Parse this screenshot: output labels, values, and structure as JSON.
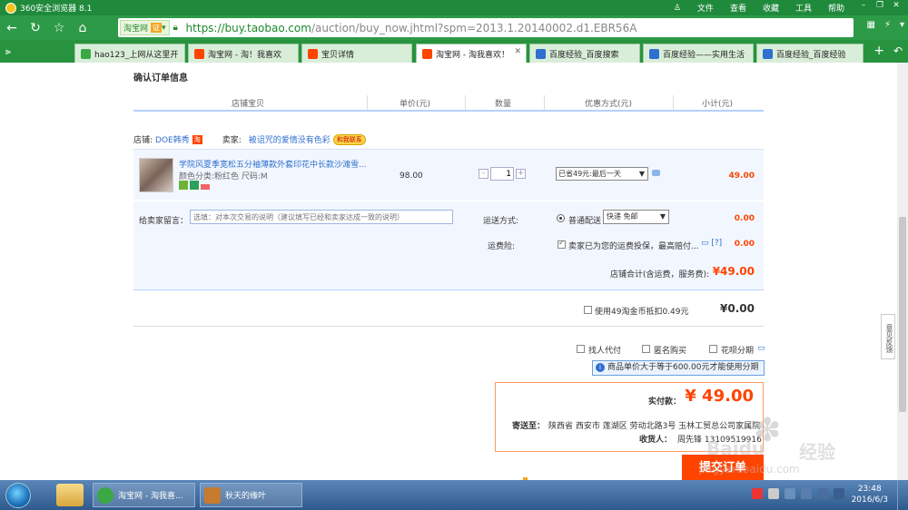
{
  "browser": {
    "title": "360安全浏览器 8.1",
    "menus": [
      "文件",
      "查看",
      "收藏",
      "工具",
      "帮助"
    ],
    "url_site": "淘宝网",
    "url_cert": "证",
    "url_host": "https://buy.taobao.com",
    "url_path": "/auction/buy_now.jhtml?spm=2013.1.20140002.d1.EBR56A",
    "tabs": [
      {
        "label": "hao123_上网从这里开",
        "color": "#3aa845"
      },
      {
        "label": "淘宝网 - 淘！我喜欢",
        "color": "#f40"
      },
      {
        "label": "宝贝详情",
        "color": "#f40"
      },
      {
        "label": "淘宝网 - 淘我喜欢！",
        "color": "#f40"
      },
      {
        "label": "百度经验_百度搜索",
        "color": "#2f6fcf"
      },
      {
        "label": "百度经验——实用生活",
        "color": "#2f6fcf"
      },
      {
        "label": "百度经验_百度经验",
        "color": "#2f6fcf"
      }
    ]
  },
  "page": {
    "confirm_title": "确认订单信息",
    "columns": [
      "店铺宝贝",
      "单价(元)",
      "数量",
      "优惠方式(元)",
      "小计(元)"
    ],
    "shop_label": "店铺:",
    "shop_name": "DOE韩秀",
    "seller_label": "卖家:",
    "seller_name": "被诅咒的爱情没有色彩",
    "contact_label": "和我联系",
    "item": {
      "title": "学院风夏季宽松五分袖薄款外套印花中长款沙滩雪...",
      "attrs": "颜色分类:粉红色  尺码:M",
      "unit_price": "98.00",
      "quantity": "1",
      "discount": "已省49元:最后一天",
      "subtotal": "49.00"
    },
    "message_label": "给卖家留言：",
    "message_placeholder": "选填：对本次交易的说明（建议填写已经和卖家达成一致的说明）",
    "shipping_label": "运送方式:",
    "shipping_option": "普通配送",
    "shipping_select": "快递 免邮",
    "shipping_fee": "0.00",
    "insurance_label": "运费险:",
    "insurance_text": "卖家已为您的运费投保，最高赔付...",
    "insurance_help": "[?]",
    "insurance_fee": "0.00",
    "shop_total_label": "店铺合计(含运费，服务费):",
    "shop_total": "¥49.00",
    "coin_text": "使用49淘金币抵扣0.49元",
    "coin_value": "¥0.00",
    "options": [
      "找人代付",
      "匿名购买",
      "花呗分期"
    ],
    "notice": "商品单价大于等于600.00元才能使用分期",
    "pay_label": "实付款：",
    "pay_value": "¥ 49.00",
    "address_label": "寄送至：",
    "address": "陕西省 西安市 莲湖区 劳动北路3号 玉林工贸总公司家属院",
    "receiver_label": "收货人：",
    "receiver": "周先锋 13109519916",
    "submit_label": "提交订单",
    "feedback": "意见反馈"
  },
  "watermark": {
    "brand": "Baidu",
    "brand2": "经验",
    "domain": "jingyan.baidu.com"
  },
  "taskbar": {
    "items": [
      "淘宝网 - 淘我喜...",
      "秋天的缘叶"
    ],
    "time": "23:48",
    "date": "2016/6/3"
  }
}
